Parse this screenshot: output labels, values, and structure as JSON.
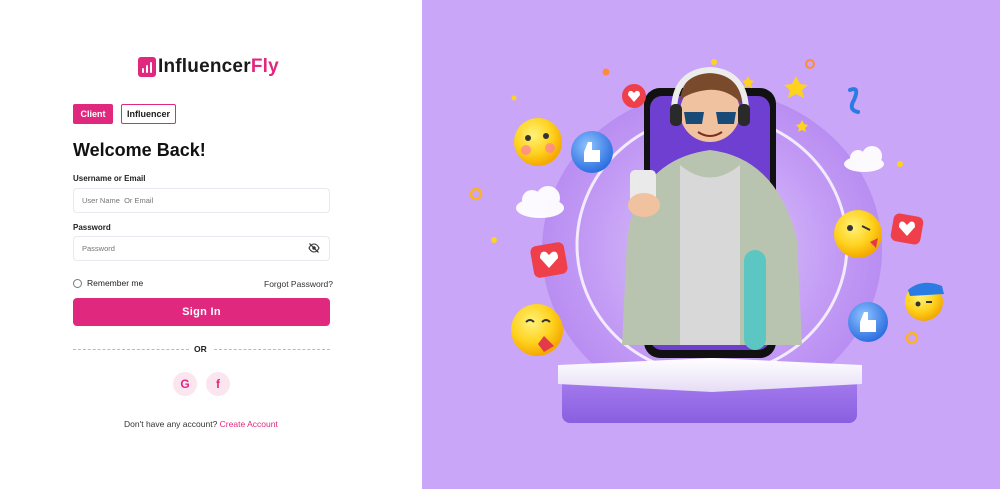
{
  "brand": {
    "name_primary": "Influencer",
    "name_accent": "Fly",
    "accent_color": "#e0287f",
    "icon": "chart-bars-icon"
  },
  "role_tabs": [
    {
      "label": "Client",
      "active": true
    },
    {
      "label": "Influencer",
      "active": false
    }
  ],
  "heading": "Welcome Back!",
  "form": {
    "username_label": "Username or Email",
    "username_placeholder": "User Name  Or Email",
    "password_label": "Password",
    "password_placeholder": "Password",
    "password_toggle_icon": "eye-slash-icon",
    "remember_label": "Remember me",
    "forgot_label": "Forgot Password?",
    "submit_label": "Sign In"
  },
  "divider_label": "OR",
  "social": [
    {
      "label": "G",
      "icon": "google-icon"
    },
    {
      "label": "f",
      "icon": "facebook-icon"
    }
  ],
  "signup": {
    "prompt": "Don't have any account?",
    "link_label": "Create Account"
  },
  "illustration": {
    "background_color": "#c9a6f7",
    "subject": "person-with-phone-illustration"
  }
}
